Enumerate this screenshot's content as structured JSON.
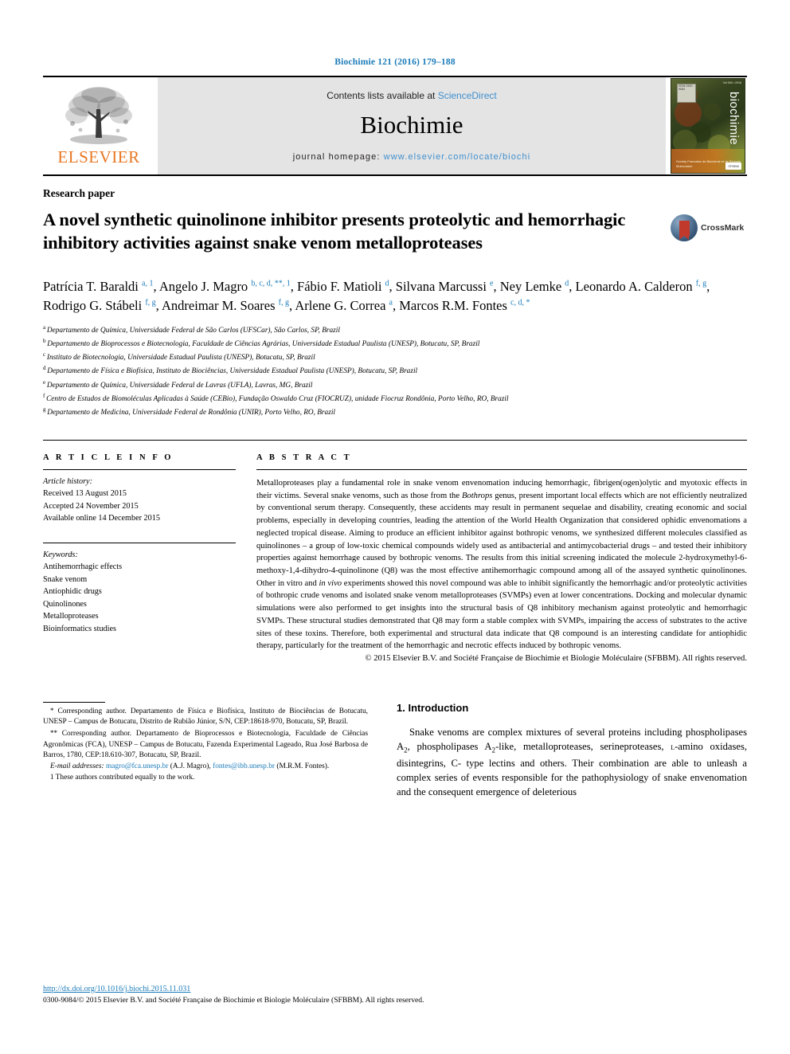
{
  "citation": "Biochimie 121 (2016) 179–188",
  "masthead": {
    "publisher": "ELSEVIER",
    "contents_prefix": "Contents lists available at ",
    "contents_link": "ScienceDirect",
    "journal": "Biochimie",
    "homepage_prefix": "journal homepage: ",
    "homepage_link": "www.elsevier.com/locate/biochi",
    "cover": {
      "title": "biochimie",
      "top_label": "Vol 000 • 2016",
      "caption": "Society Francaise de\nBiochimie et de Biologie\nMoleculaire",
      "seal": "SFBBM",
      "stamp": "ISSN 0300-9084"
    }
  },
  "article": {
    "type": "Research paper",
    "title": "A novel synthetic quinolinone inhibitor presents proteolytic and hemorrhagic inhibitory activities against snake venom metalloproteases",
    "crossmark_label": "CrossMark"
  },
  "authors": [
    {
      "name": "Patrícia T. Baraldi",
      "sup": "a, 1",
      "sep": ", "
    },
    {
      "name": "Angelo J. Magro",
      "sup": "b, c, d, **, 1",
      "sep": ", "
    },
    {
      "name": "Fábio F. Matioli",
      "sup": "d",
      "sep": ", "
    },
    {
      "name": "Silvana Marcussi",
      "sup": "e",
      "sep": ", "
    },
    {
      "name": "Ney Lemke",
      "sup": "d",
      "sep": ", "
    },
    {
      "name": "Leonardo A. Calderon",
      "sup": "f, g",
      "sep": ", "
    },
    {
      "name": "Rodrigo G. Stábeli",
      "sup": "f, g",
      "sep": ", "
    },
    {
      "name": "Andreimar M. Soares",
      "sup": "f, g",
      "sep": ", "
    },
    {
      "name": "Arlene G. Correa",
      "sup": "a",
      "sep": ", "
    },
    {
      "name": "Marcos R.M. Fontes",
      "sup": "c, d, *",
      "sep": ""
    }
  ],
  "affiliations": [
    {
      "mark": "a",
      "text": "Departamento de Química, Universidade Federal de São Carlos (UFSCar), São Carlos, SP, Brazil"
    },
    {
      "mark": "b",
      "text": "Departamento de Bioprocessos e Biotecnologia, Faculdade de Ciências Agrárias, Universidade Estadual Paulista (UNESP), Botucatu, SP, Brazil"
    },
    {
      "mark": "c",
      "text": "Instituto de Biotecnologia, Universidade Estadual Paulista (UNESP), Botucatu, SP, Brazil"
    },
    {
      "mark": "d",
      "text": "Departamento de Física e Biofísica, Instituto de Biociências, Universidade Estadual Paulista (UNESP), Botucatu, SP, Brazil"
    },
    {
      "mark": "e",
      "text": "Departamento de Química, Universidade Federal de Lavras (UFLA), Lavras, MG, Brazil"
    },
    {
      "mark": "f",
      "text": "Centro de Estudos de Biomoléculas Aplicadas à Saúde (CEBio), Fundação Oswaldo Cruz (FIOCRUZ), unidade Fiocruz Rondônia, Porto Velho, RO, Brazil"
    },
    {
      "mark": "g",
      "text": "Departamento de Medicina, Universidade Federal de Rondônia (UNIR), Porto Velho, RO, Brazil"
    }
  ],
  "article_info": {
    "heading": "A R T I C L E  I N F O",
    "history_label": "Article history:",
    "history": [
      "Received 13 August 2015",
      "Accepted 24 November 2015",
      "Available online 14 December 2015"
    ],
    "keywords_label": "Keywords:",
    "keywords": [
      "Antihemorrhagic effects",
      "Snake venom",
      "Antiophidic drugs",
      "Quinolinones",
      "Metalloproteases",
      "Bioinformatics studies"
    ]
  },
  "abstract": {
    "heading": "A B S T R A C T",
    "part1": "Metalloproteases play a fundamental role in snake venom envenomation inducing hemorrhagic, fibrigen(ogen)olytic and myotoxic effects in their victims. Several snake venoms, such as those from the ",
    "genus_italic": "Bothrops",
    "part2": " genus, present important local effects which are not efficiently neutralized by conventional serum therapy. Consequently, these accidents may result in permanent sequelae and disability, creating economic and social problems, especially in developing countries, leading the attention of the World Health Organization that considered ophidic envenomations a neglected tropical disease. Aiming to produce an efficient inhibitor against bothropic venoms, we synthesized different molecules classified as quinolinones – a group of low-toxic chemical compounds widely used as antibacterial and antimycobacterial drugs – and tested their inhibitory properties against hemorrhage caused by bothropic venoms. The results from this initial screening indicated the molecule 2-hydroxymethyl-6-methoxy-1,4-dihydro-4-quinolinone (Q8) was the most effective antihemorrhagic compound among all of the assayed synthetic quinolinones. Other in vitro and ",
    "invivo_italic": "in vivo",
    "part3": " experiments showed this novel compound was able to inhibit significantly the hemorrhagic and/or proteolytic activities of bothropic crude venoms and isolated snake venom metalloproteases (SVMPs) even at lower concentrations. Docking and molecular dynamic simulations were also performed to get insights into the structural basis of Q8 inhibitory mechanism against proteolytic and hemorrhagic SVMPs. These structural studies demonstrated that Q8 may form a stable complex with SVMPs, impairing the access of substrates to the active sites of these toxins. Therefore, both experimental and structural data indicate that Q8 compound is an interesting candidate for antiophidic therapy, particularly for the treatment of the hemorrhagic and necrotic effects induced by bothropic venoms.",
    "copyright": "© 2015 Elsevier B.V. and Société Française de Biochimie et Biologie Moléculaire (SFBBM). All rights reserved."
  },
  "footnotes": {
    "corresponding1_marker": "*",
    "corresponding1": " Corresponding author. Departamento de Física e Biofísica, Instituto de Biociências de Botucatu, UNESP – Campus de Botucatu, Distrito de Rubião Júnior, S/N, CEP:18618-970, Botucatu, SP, Brazil.",
    "corresponding2_marker": "**",
    "corresponding2": " Corresponding author. Departamento de Bioprocessos e Biotecnologia, Faculdade de Ciências Agronômicas (FCA), UNESP – Campus de Botucatu, Fazenda Experimental Lageado, Rua José Barbosa de Barros, 1780, CEP:18.610-307, Botucatu, SP, Brazil.",
    "email_label": "E-mail addresses:",
    "email1": "magro@fca.unesp.br",
    "email1_owner": " (A.J. Magro), ",
    "email2": "fontes@ibb.unesp.br",
    "email2_owner": " (M.R.M. Fontes).",
    "equal_marker": "1",
    "equal_contrib": " These authors contributed equally to the work."
  },
  "introduction": {
    "heading": "1. Introduction",
    "paragraph_a": "Snake venoms are complex mixtures of several proteins including phospholipases A",
    "sub_1": "2",
    "paragraph_b": ", phospholipases A",
    "sub_2": "2",
    "paragraph_c": "-like, metalloproteases, serineproteases, ",
    "smallcaps": "l",
    "paragraph_d": "-amino oxidases, disintegrins, C- type lectins and others. Their combination are able to unleash a complex series of events responsible for the pathophysiology of snake envenomation and the consequent emergence of deleterious"
  },
  "footer": {
    "doi": "http://dx.doi.org/10.1016/j.biochi.2015.11.031",
    "issn": "0300-9084/© 2015 Elsevier B.V. and Société Française de Biochimie et Biologie Moléculaire (SFBBM). All rights reserved."
  }
}
